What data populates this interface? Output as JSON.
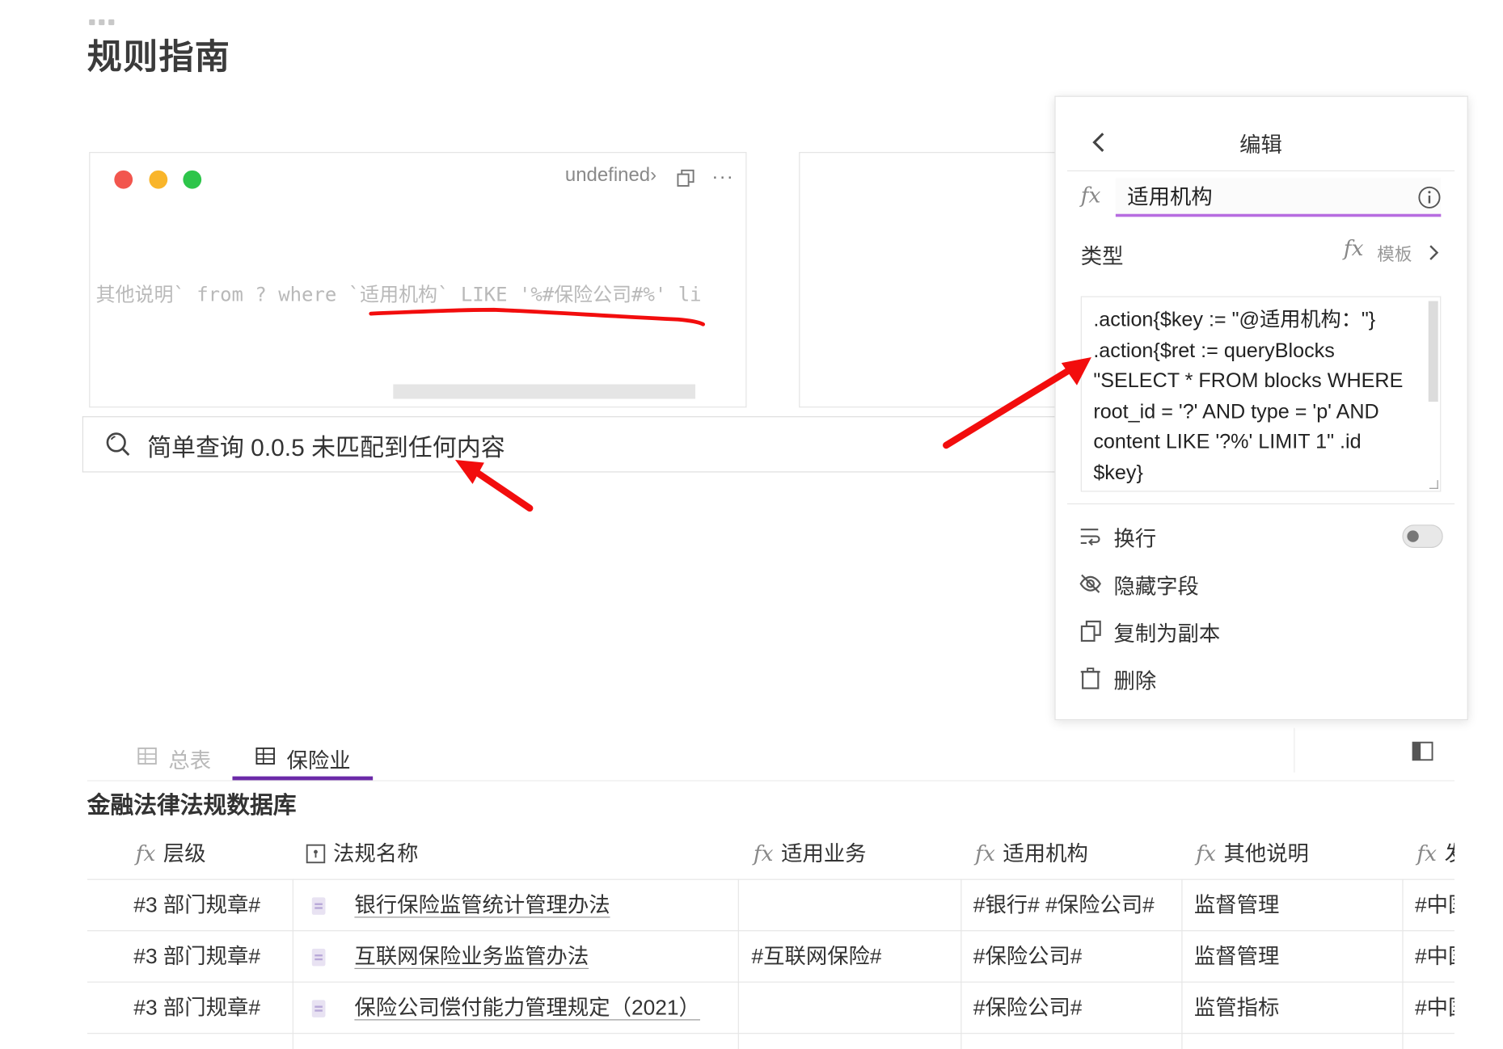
{
  "page": {
    "title": "规则指南"
  },
  "code_block": {
    "lang": "undefined›",
    "code": "其他说明` from ? where `适用机构` LIKE '%#保险公司#%' li"
  },
  "search_bar": {
    "text": "简单查询 0.0.5  未匹配到任何内容"
  },
  "edit_panel": {
    "title": "编辑",
    "field_name": "适用机构",
    "type_label": "类型",
    "type_value": "模板",
    "template": ".action{$key := \"@适用机构：\"} .action{$ret := queryBlocks \"SELECT * FROM blocks WHERE root_id = '?' AND type = 'p' AND content LIKE '?%' LIMIT 1\" .id $key}",
    "menu": {
      "wrap": "换行",
      "hide_field": "隐藏字段",
      "duplicate": "复制为副本",
      "delete": "删除"
    },
    "wrap_enabled": false
  },
  "tabs": [
    {
      "label": "总表",
      "active": false
    },
    {
      "label": "保险业",
      "active": true
    }
  ],
  "database": {
    "title": "金融法律法规数据库",
    "columns": [
      "层级",
      "法规名称",
      "适用业务",
      "适用机构",
      "其他说明",
      "发"
    ],
    "rows": [
      {
        "level": "#3 部门规章#",
        "name": "银行保险监管统计管理办法",
        "business": "",
        "institution": "#银行# #保险公司#",
        "note": "监督管理",
        "issuer": "#中国"
      },
      {
        "level": "#3 部门规章#",
        "name": "互联网保险业务监管办法",
        "business": "#互联网保险#",
        "institution": "#保险公司#",
        "note": "监督管理",
        "issuer": "#中国"
      },
      {
        "level": "#3 部门规章#",
        "name": "保险公司偿付能力管理规定（2021）",
        "business": "",
        "institution": "#保险公司#",
        "note": "监管指标",
        "issuer": "#中国"
      }
    ]
  },
  "colors": {
    "accent": "#6b2aa8",
    "annotation": "#f20d0d",
    "field_underline": "#b76ce0"
  }
}
